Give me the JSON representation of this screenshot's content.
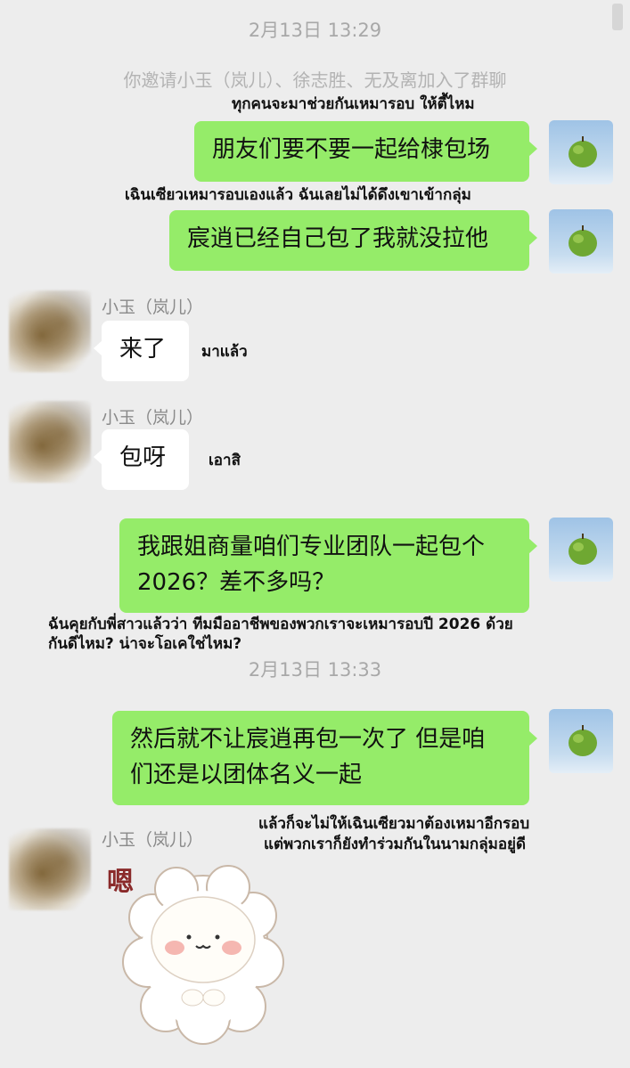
{
  "timestamps": [
    "2月13日 13:29",
    "2月13日 13:33"
  ],
  "system_message": "你邀请小玉（岚儿）、徐志胜、无及离加入了群聊",
  "messages": [
    {
      "sender": "me",
      "text": "朋友们要不要一起给棣包场",
      "translation": "ทุกคนจะมาช่วยกันเหมารอบ ให้ตี้ไหม"
    },
    {
      "sender": "me",
      "text": "宸逍已经自己包了我就没拉他",
      "translation": "เฉินเซียวเหมารอบเองแล้ว ฉันเลยไม่ได้ดึงเขาเข้ากลุ่ม"
    },
    {
      "sender": "小玉（岚儿）",
      "text": "来了",
      "translation": "มาแล้ว"
    },
    {
      "sender": "小玉（岚儿）",
      "text": "包呀",
      "translation": "เอาสิ"
    },
    {
      "sender": "me",
      "text_lines": [
        "我跟姐商量咱们专业团队一起包个",
        "2026？差不多吗？"
      ],
      "translation_lines": [
        "ฉันคุยกับพี่สาวแล้วว่า ทีมมืออาชีพของพวกเราจะเหมารอบปี 2026 ด้วย",
        "กันดีไหม? น่าจะโอเคใช่ไหม?"
      ]
    },
    {
      "sender": "me",
      "text_lines": [
        "然后就不让宸逍再包一次了 但是咱",
        "们还是以团体名义一起"
      ],
      "translation_lines": [
        "แล้วก็จะไม่ให้เฉินเซียวมาต้องเหมาอีกรอบ",
        "แต่พวกเราก็ยังทำร่วมกันในนามกลุ่มอยู่ดี"
      ]
    },
    {
      "sender": "小玉（岚儿）",
      "sticker": "sheep-sticker",
      "sticker_text": "嗯"
    }
  ],
  "sender_name": "小玉（岚儿）",
  "colors": {
    "outgoing_bubble": "#95ec69",
    "incoming_bubble": "#ffffff",
    "background": "#ededed"
  }
}
